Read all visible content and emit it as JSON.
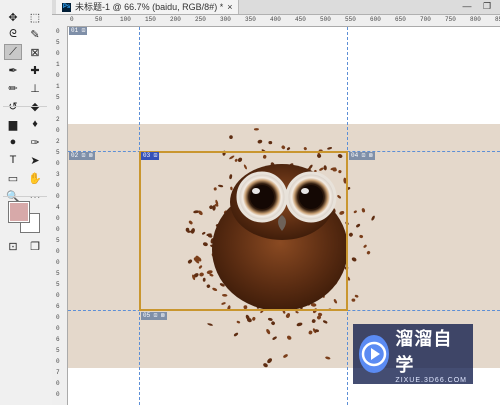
{
  "document_tab": {
    "title": "未标题-1 @ 66.7% (baidu, RGB/8#) *",
    "close": "×"
  },
  "window_controls": {
    "minimize": "—",
    "restore": "❐"
  },
  "toolbar": {
    "tools": [
      {
        "name": "move-tool",
        "glyph": "✥"
      },
      {
        "name": "marquee-tool",
        "glyph": "⬚"
      },
      {
        "name": "lasso-tool",
        "glyph": "ᘓ"
      },
      {
        "name": "quick-select-tool",
        "glyph": "✎"
      },
      {
        "name": "slice-tool",
        "glyph": "⟋",
        "active": true
      },
      {
        "name": "frame-tool",
        "glyph": "⊠"
      },
      {
        "name": "eyedropper-tool",
        "glyph": "✒"
      },
      {
        "name": "healing-brush-tool",
        "glyph": "✚"
      },
      {
        "name": "brush-tool",
        "glyph": "✏"
      },
      {
        "name": "stamp-tool",
        "glyph": "⊥"
      },
      {
        "name": "history-brush-tool",
        "glyph": "↺"
      },
      {
        "name": "eraser-tool",
        "glyph": "◆"
      },
      {
        "name": "gradient-tool",
        "glyph": "▆"
      },
      {
        "name": "blur-tool",
        "glyph": "♦"
      },
      {
        "name": "dodge-tool",
        "glyph": "●"
      },
      {
        "name": "pen-tool",
        "glyph": "✑"
      },
      {
        "name": "type-tool",
        "glyph": "T"
      },
      {
        "name": "path-select-tool",
        "glyph": "➤"
      },
      {
        "name": "shape-tool",
        "glyph": "▭"
      },
      {
        "name": "hand-tool",
        "glyph": "✋"
      },
      {
        "name": "zoom-tool",
        "glyph": "🔍"
      },
      {
        "name": "more-tools",
        "glyph": "⋯"
      }
    ],
    "fg_color": "#d7a9a9",
    "bg_color": "#ffffff",
    "quickmask_glyph": "⊡",
    "screenmode_glyph": "❐"
  },
  "ruler_h_labels": [
    "0",
    "50",
    "100",
    "150",
    "200",
    "250",
    "300",
    "350",
    "400",
    "450",
    "500",
    "550",
    "600",
    "650",
    "700",
    "750",
    "800",
    "850"
  ],
  "ruler_v_labels": [
    "0",
    "5",
    "0",
    "1",
    "0",
    "1",
    "5",
    "0",
    "2",
    "0",
    "2",
    "5",
    "0",
    "3",
    "0",
    "0",
    "4",
    "0",
    "0",
    "5",
    "0",
    "0",
    "5",
    "5",
    "0",
    "6",
    "0",
    "0",
    "6",
    "5",
    "0",
    "7",
    "0",
    "0"
  ],
  "slices": {
    "s01": "01 ⊡",
    "s02": "02 ⊡ ⊠",
    "s03": "03 ⊡",
    "s04": "04 ⊡ ⊠",
    "s05": "05 ⊡ ⊠"
  },
  "watermark": {
    "title": "溜溜自学",
    "subtitle": "ZIXUE.3D66.COM"
  }
}
